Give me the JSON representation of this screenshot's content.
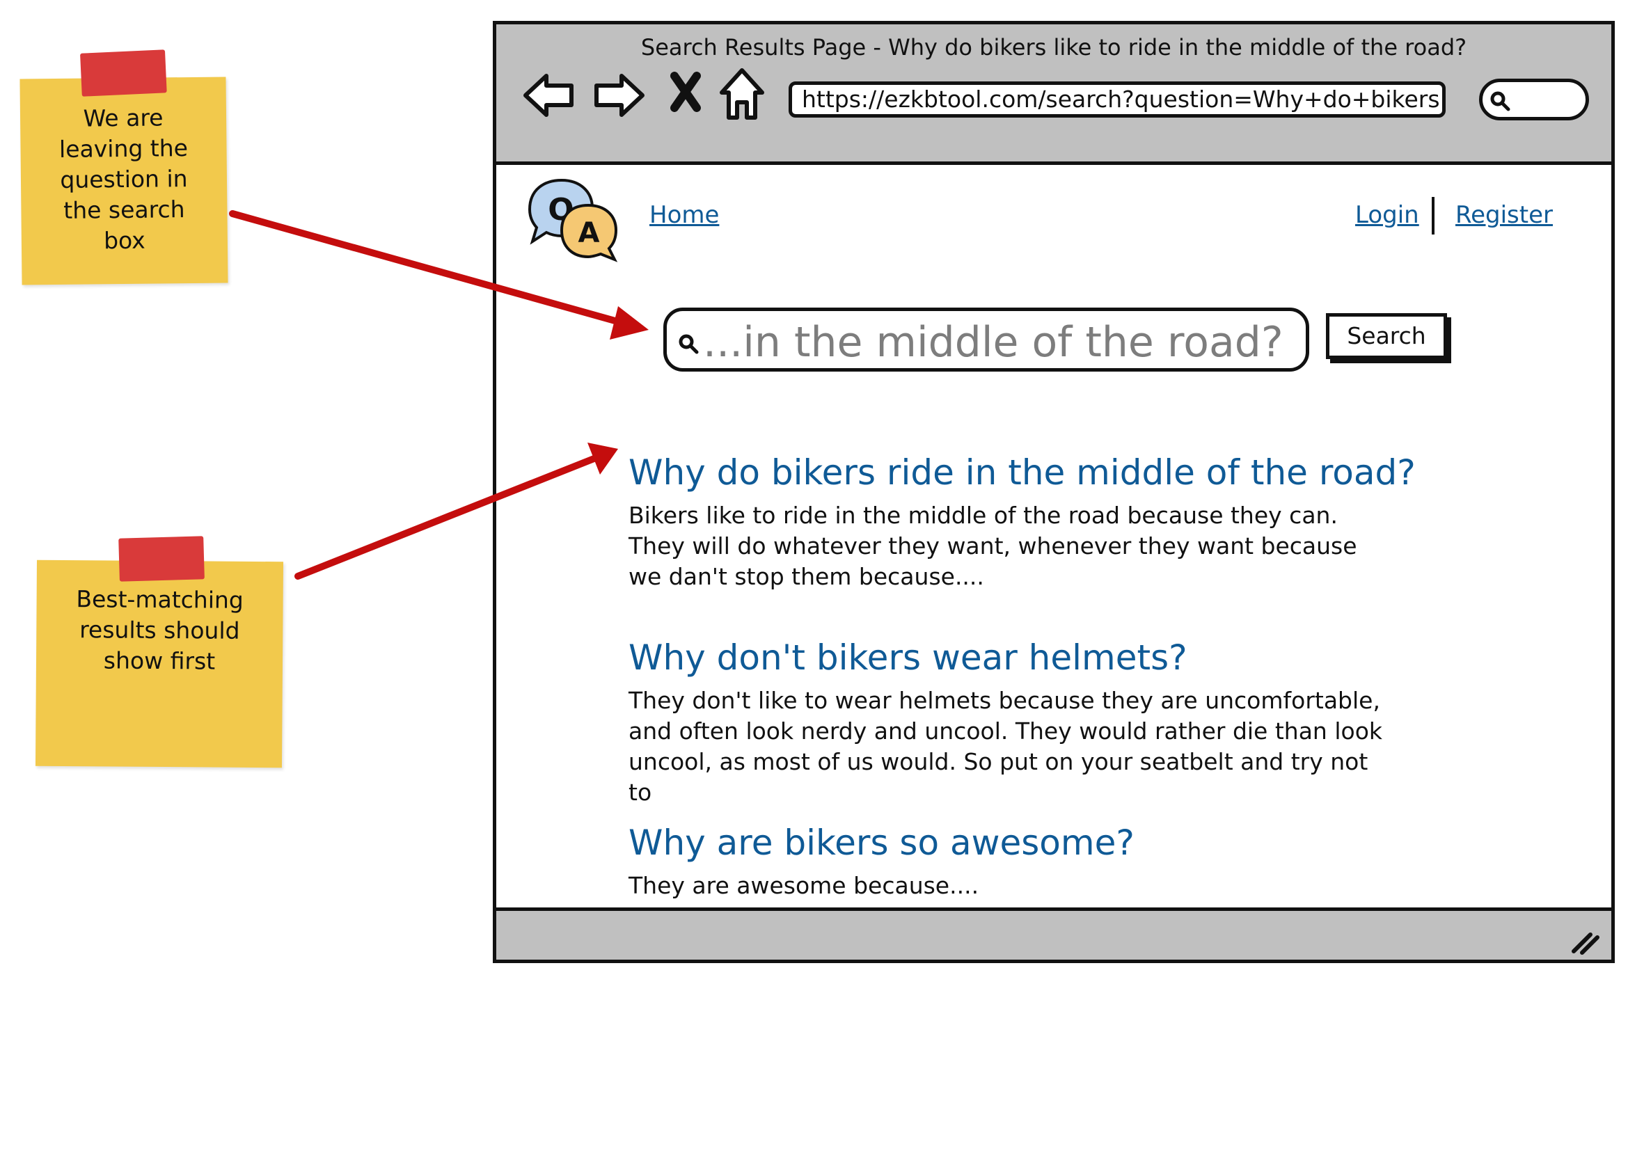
{
  "notes": [
    {
      "text": "We are\nleaving the\nquestion in\nthe search\nbox"
    },
    {
      "text": "Best-matching\nresults should\nshow first"
    }
  ],
  "window": {
    "title": "Search Results Page - Why do bikers like to ride in the middle of the road?",
    "url": "https://ezkbtool.com/search?question=Why+do+bikers..",
    "nav_icons": [
      "back-icon",
      "forward-icon",
      "stop-icon",
      "home-icon"
    ]
  },
  "header": {
    "logo_icon": "qa-chat-bubbles-icon",
    "home_label": "Home",
    "login_label": "Login",
    "register_label": "Register"
  },
  "search": {
    "value": "...in the middle of the road?",
    "button_label": "Search"
  },
  "results": [
    {
      "title": "Why do bikers ride in the middle of the road?",
      "snippet": "Bikers like to ride in the middle of the road because they can. They will do whatever they want, whenever they want because we dan't stop them because...."
    },
    {
      "title": "Why don't bikers wear helmets?",
      "snippet": "They don't like to wear helmets because they are uncomfortable, and often look nerdy and uncool. They would rather die than look uncool, as most of us would. So put on your seatbelt and try not to"
    },
    {
      "title": "Why are bikers so awesome?",
      "snippet": "They are awesome because...."
    }
  ],
  "colors": {
    "link": "#0f5a96",
    "sticky": "#f2c94c",
    "tape": "#d93a3a",
    "arrow": "#c40d0d",
    "chrome": "#c0c0c0"
  }
}
